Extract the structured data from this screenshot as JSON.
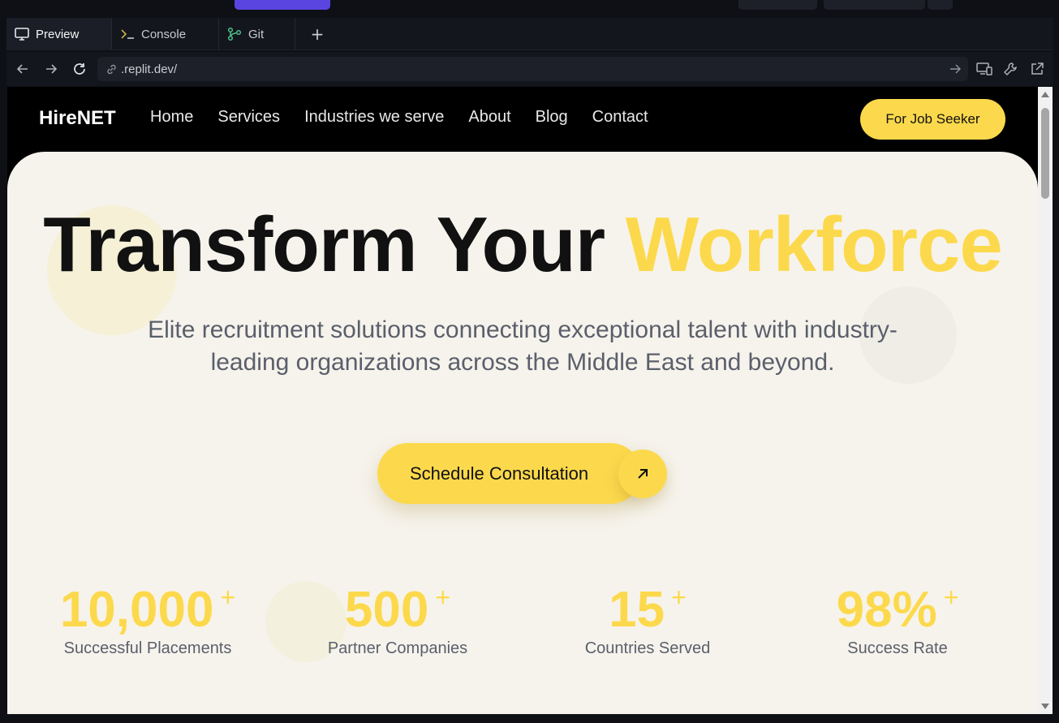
{
  "ide": {
    "tabs": [
      {
        "label": "Preview",
        "icon": "monitor-icon"
      },
      {
        "label": "Console",
        "icon": "terminal-icon"
      },
      {
        "label": "Git",
        "icon": "git-branch-icon"
      }
    ],
    "add_tab": "+",
    "url": ".replit.dev/"
  },
  "site": {
    "logo": "HireNET",
    "nav": [
      "Home",
      "Services",
      "Industries we serve",
      "About",
      "Blog",
      "Contact"
    ],
    "job_seeker_button": "For Job Seeker",
    "hero": {
      "title_dark": "Transform Your ",
      "title_highlight": "Workforce",
      "subtitle": "Elite recruitment solutions connecting exceptional talent with industry-leading organizations across the Middle East and beyond.",
      "cta": "Schedule Consultation"
    },
    "stats": [
      {
        "value": "10,000",
        "suffix": "+",
        "label": "Successful Placements"
      },
      {
        "value": "500",
        "suffix": "+",
        "label": "Partner Companies"
      },
      {
        "value": "15",
        "suffix": "+",
        "label": "Countries Served"
      },
      {
        "value": "98%",
        "suffix": "+",
        "label": "Success Rate"
      }
    ]
  },
  "colors": {
    "accent": "#fcd94c",
    "hero_bg": "#f6f3ec",
    "ide_bg": "#14161d"
  }
}
